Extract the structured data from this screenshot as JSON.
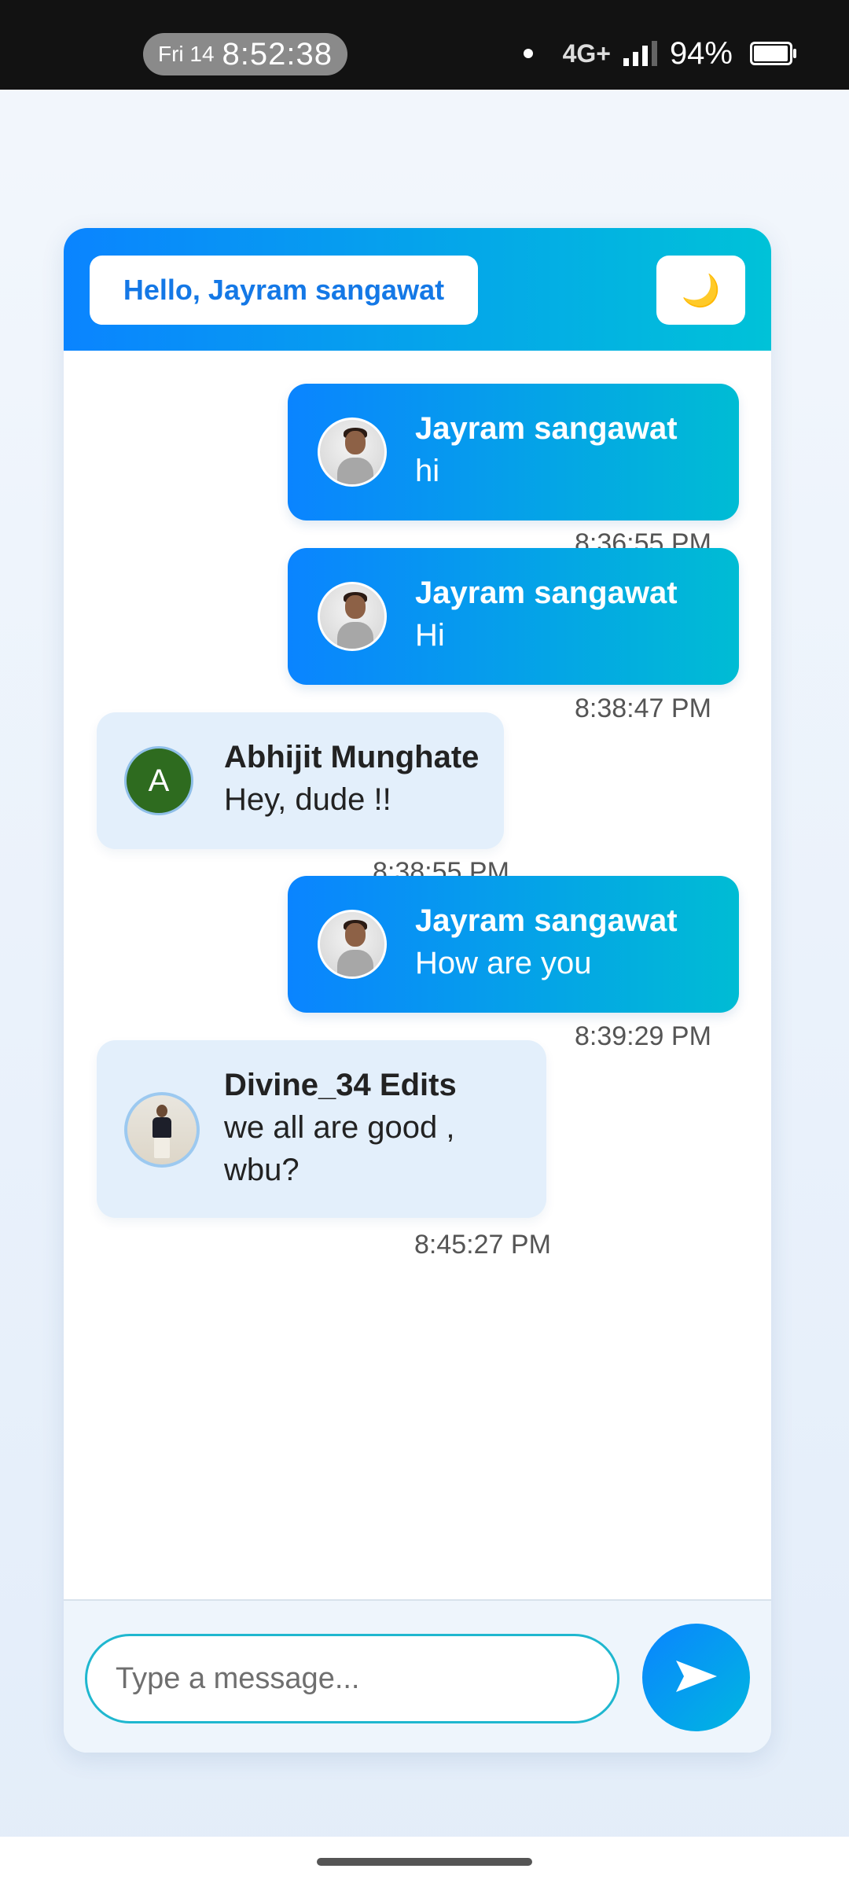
{
  "status_bar": {
    "day": "Fri 14",
    "time": "8:52:38",
    "network": "4G+",
    "battery": "94%",
    "battery_level": 0.94
  },
  "header": {
    "greeting": "Hello, Jayram sangawat",
    "theme_icon": "🌙"
  },
  "messages": [
    {
      "sender": "Jayram sangawat",
      "text": "hi",
      "time": "8:36:55 PM",
      "mine": true,
      "avatar": "photo"
    },
    {
      "sender": "Jayram sangawat",
      "text": "Hi",
      "time": "8:38:47 PM",
      "mine": true,
      "avatar": "photo"
    },
    {
      "sender": "Abhijit Munghate",
      "text": "Hey, dude !!",
      "time": "8:38:55 PM",
      "mine": false,
      "avatar": "letter",
      "avatar_letter": "A",
      "avatar_color": "#2e6b1f"
    },
    {
      "sender": "Jayram sangawat",
      "text": "How are you",
      "time": "8:39:29 PM",
      "mine": true,
      "avatar": "photo"
    },
    {
      "sender": "Divine_34 Edits",
      "text": "we all are good ,",
      "text_line2": "wbu?",
      "time": "8:45:27 PM",
      "mine": false,
      "avatar": "photo"
    }
  ],
  "composer": {
    "placeholder": "Type a message...",
    "send_icon": "send-icon"
  },
  "colors": {
    "accent_start": "#0a84ff",
    "accent_end": "#00c2d8",
    "other_bubble": "#e3effb"
  }
}
